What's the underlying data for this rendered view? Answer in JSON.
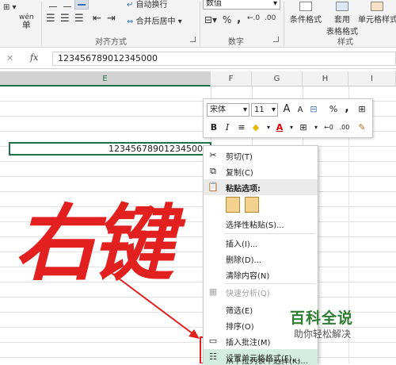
{
  "ribbon": {
    "sheng_label": "单",
    "wen_label": "wén\n文",
    "wrap_text_label": "自动换行",
    "merge_center_label": "合并后居中",
    "number_format_value": "数值",
    "percent_label": "%",
    "comma_label": ",",
    "dec_label": ".00",
    "cond_format_label": "条件格式",
    "table_format_label_1": "套用",
    "table_format_label_2": "表格格式",
    "cell_style_label": "单元格样式",
    "group_alignment": "对齐方式",
    "group_number": "数字",
    "group_styles": "样式"
  },
  "formula_bar": {
    "cancel": "✕",
    "confirm": "✓",
    "fx": "fx",
    "value": "123456789012345000"
  },
  "columns": [
    "E",
    "F",
    "G",
    "H",
    "I"
  ],
  "selected_column": "E",
  "active_cell_value": "123456789012345000",
  "mini_toolbar": {
    "font_name": "宋体",
    "font_size": "11",
    "bold": "B",
    "italic": "I",
    "grow_font": "A",
    "shrink_font": "A",
    "percent": "%",
    "comma": ","
  },
  "context_menu": [
    {
      "label": "剪切(T)",
      "icon": "scissors-icon",
      "state": "normal"
    },
    {
      "label": "复制(C)",
      "icon": "copy-icon",
      "state": "normal"
    },
    {
      "label": "粘贴选项:",
      "icon": "paste-icon",
      "state": "header"
    },
    {
      "label": "",
      "icon": "",
      "state": "paste-icons"
    },
    {
      "label": "选择性粘贴(S)...",
      "icon": "",
      "state": "normal"
    },
    {
      "label": "插入(I)...",
      "icon": "",
      "state": "normal"
    },
    {
      "label": "删除(D)...",
      "icon": "",
      "state": "normal"
    },
    {
      "label": "清除内容(N)",
      "icon": "",
      "state": "normal"
    },
    {
      "label": "快速分析(Q)",
      "icon": "quick-analysis-icon",
      "state": "disabled"
    },
    {
      "label": "筛选(E)",
      "icon": "",
      "state": "normal"
    },
    {
      "label": "排序(O)",
      "icon": "",
      "state": "normal"
    },
    {
      "label": "插入批注(M)",
      "icon": "comment-icon",
      "state": "normal"
    },
    {
      "label": "设置单元格格式(F)...",
      "icon": "format-cells-icon",
      "state": "highlighted"
    },
    {
      "label": "从下拉列表中选择(K)...",
      "icon": "",
      "state": "normal"
    }
  ],
  "annotation": {
    "handwritten": "右键"
  },
  "watermark": {
    "title": "百科全说",
    "subtitle": "助你轻松解决"
  },
  "colors": {
    "excel_green": "#217346",
    "annotation_red": "#e32020",
    "highlight": "#d3eee0"
  }
}
